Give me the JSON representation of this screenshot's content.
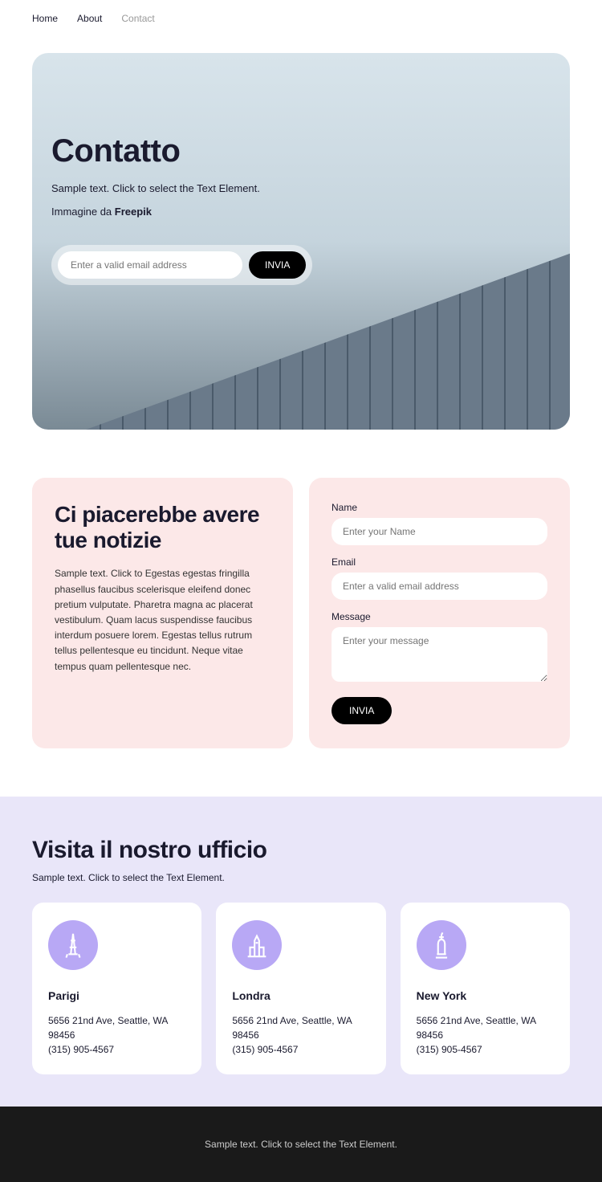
{
  "nav": {
    "home": "Home",
    "about": "About",
    "contact": "Contact"
  },
  "hero": {
    "title": "Contatto",
    "desc": "Sample text. Click to select the Text Element.",
    "credit_prefix": "Immagine da ",
    "credit_bold": "Freepik",
    "email_placeholder": "Enter a valid email address",
    "submit": "INVIA"
  },
  "contact": {
    "title": "Ci piacerebbe avere tue notizie",
    "desc": "Sample text. Click to Egestas egestas fringilla phasellus faucibus scelerisque eleifend donec pretium vulputate. Pharetra magna ac placerat vestibulum. Quam lacus suspendisse faucibus interdum posuere lorem. Egestas tellus rutrum tellus pellentesque eu tincidunt. Neque vitae tempus quam pellentesque nec.",
    "name_label": "Name",
    "name_ph": "Enter your Name",
    "email_label": "Email",
    "email_ph": "Enter a valid email address",
    "msg_label": "Message",
    "msg_ph": "Enter your message",
    "submit": "INVIA"
  },
  "offices": {
    "title": "Visita il nostro ufficio",
    "desc": "Sample text. Click to select the Text Element.",
    "items": [
      {
        "city": "Parigi",
        "addr": "5656 21nd Ave, Seattle, WA 98456",
        "phone": "(315) 905-4567"
      },
      {
        "city": "Londra",
        "addr": "5656 21nd Ave, Seattle, WA 98456",
        "phone": "(315) 905-4567"
      },
      {
        "city": "New York",
        "addr": "5656 21nd Ave, Seattle, WA 98456",
        "phone": "(315) 905-4567"
      }
    ]
  },
  "footer": {
    "text": "Sample text. Click to select the Text Element."
  }
}
